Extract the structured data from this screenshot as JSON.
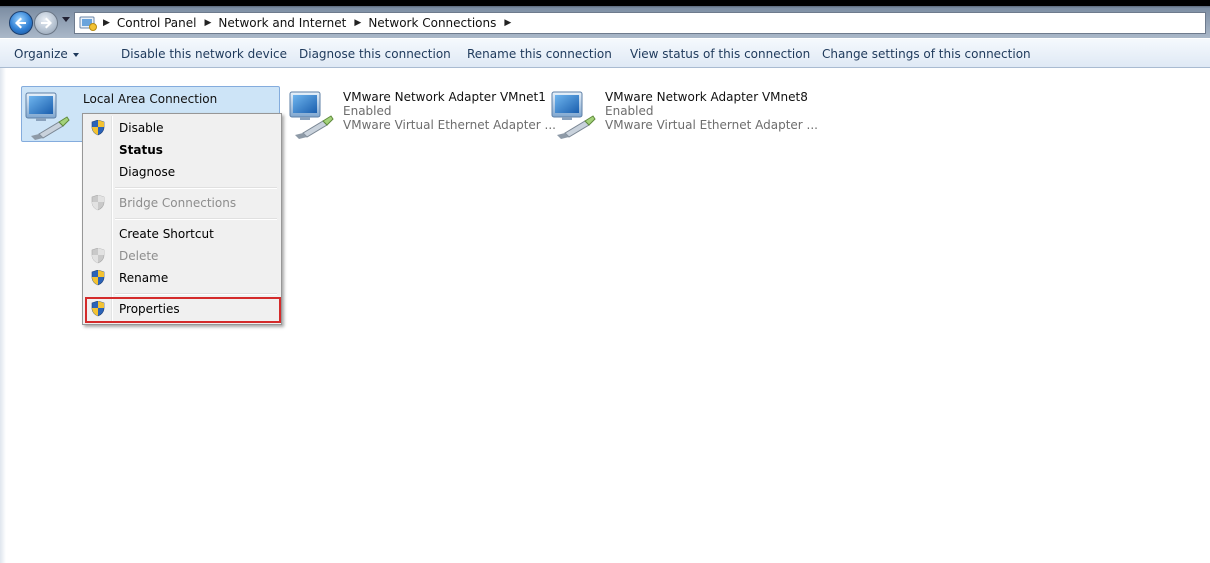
{
  "window": {
    "breadcrumbs": [
      "Control Panel",
      "Network and Internet",
      "Network Connections"
    ]
  },
  "toolbar": {
    "organize": "Organize",
    "disable": "Disable this network device",
    "diagnose": "Diagnose this connection",
    "rename": "Rename this connection",
    "view_status": "View status of this connection",
    "change_settings": "Change settings of this connection"
  },
  "connections": [
    {
      "name": "Local Area Connection",
      "status": "",
      "device": ""
    },
    {
      "name": "VMware Network Adapter VMnet1",
      "status": "Enabled",
      "device": "VMware Virtual Ethernet Adapter ..."
    },
    {
      "name": "VMware Network Adapter VMnet8",
      "status": "Enabled",
      "device": "VMware Virtual Ethernet Adapter ..."
    }
  ],
  "context_menu": {
    "items": [
      {
        "label": "Disable",
        "shield": true,
        "enabled": true,
        "bold": false
      },
      {
        "label": "Status",
        "shield": false,
        "enabled": true,
        "bold": true
      },
      {
        "label": "Diagnose",
        "shield": false,
        "enabled": true,
        "bold": false
      },
      {
        "label": "Bridge Connections",
        "shield": true,
        "enabled": false,
        "bold": false
      },
      {
        "label": "Create Shortcut",
        "shield": false,
        "enabled": true,
        "bold": false
      },
      {
        "label": "Delete",
        "shield": true,
        "enabled": false,
        "bold": false
      },
      {
        "label": "Rename",
        "shield": true,
        "enabled": true,
        "bold": false
      },
      {
        "label": "Properties",
        "shield": true,
        "enabled": true,
        "bold": false,
        "highlighted": true
      }
    ]
  },
  "colors": {
    "selection_bg": "#cde4f7",
    "highlight_border": "#d42b2b",
    "toolbar_text": "#1e395b"
  },
  "icons": {
    "back": "back-arrow-icon",
    "forward": "forward-arrow-icon",
    "folder": "control-panel-icon",
    "network": "network-adapter-icon",
    "shield": "uac-shield-icon"
  }
}
